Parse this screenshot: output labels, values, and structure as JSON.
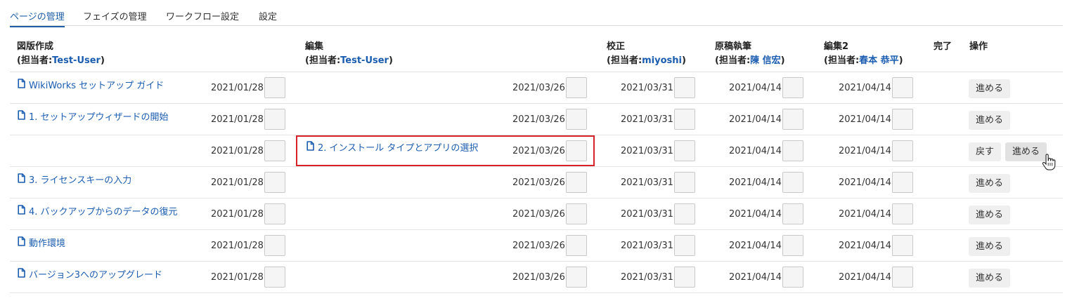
{
  "tabs": [
    {
      "label": "ページの管理",
      "active": true
    },
    {
      "label": "フェイズの管理",
      "active": false
    },
    {
      "label": "ワークフロー設定",
      "active": false
    },
    {
      "label": "設定",
      "active": false
    }
  ],
  "columns": {
    "zuhan": {
      "title": "図版作成",
      "assignee_prefix": "(担当者:",
      "assignee": "Test-User",
      "assignee_suffix": ")"
    },
    "henshu": {
      "title": "編集",
      "assignee_prefix": "(担当者:",
      "assignee": "Test-User",
      "assignee_suffix": ")"
    },
    "kosei": {
      "title": "校正",
      "assignee_prefix": "(担当者:",
      "assignee": "miyoshi",
      "assignee_suffix": ")"
    },
    "genko": {
      "title": "原稿執筆",
      "assignee_prefix": "(担当者:",
      "assignee": "陳 信宏",
      "assignee_suffix": ")"
    },
    "henshu2": {
      "title": "編集2",
      "assignee_prefix": "(担当者:",
      "assignee": "春本 恭平",
      "assignee_suffix": ")"
    },
    "kanryo": {
      "title": "完了"
    },
    "sosa": {
      "title": "操作"
    }
  },
  "rows": [
    {
      "page": "WikiWorks セットアップ ガイド",
      "d1": "2021/01/28",
      "d2": "2021/03/26",
      "d3": "2021/03/31",
      "d4": "2021/04/14",
      "d5": "2021/04/14",
      "advance": "進める"
    },
    {
      "page": "1. セットアップウィザードの開始",
      "d1": "2021/01/28",
      "d2": "2021/03/26",
      "d3": "2021/03/31",
      "d4": "2021/04/14",
      "d5": "2021/04/14",
      "advance": "進める"
    },
    {
      "page": "2. インストール タイプとアプリの選択",
      "d1": "2021/01/28",
      "d2": "2021/03/26",
      "d3": "2021/03/31",
      "d4": "2021/04/14",
      "d5": "2021/04/14",
      "back": "戻す",
      "advance": "進める"
    },
    {
      "page": "3. ライセンスキーの入力",
      "d1": "2021/01/28",
      "d2": "2021/03/26",
      "d3": "2021/03/31",
      "d4": "2021/04/14",
      "d5": "2021/04/14",
      "advance": "進める"
    },
    {
      "page": "4. バックアップからのデータの復元",
      "d1": "2021/01/28",
      "d2": "2021/03/26",
      "d3": "2021/03/31",
      "d4": "2021/04/14",
      "d5": "2021/04/14",
      "advance": "進める"
    },
    {
      "page": "動作環境",
      "d1": "2021/01/28",
      "d2": "2021/03/26",
      "d3": "2021/03/31",
      "d4": "2021/04/14",
      "d5": "2021/04/14",
      "advance": "進める"
    },
    {
      "page": "バージョン3へのアップグレード",
      "d1": "2021/01/28",
      "d2": "2021/03/26",
      "d3": "2021/03/31",
      "d4": "2021/04/14",
      "d5": "2021/04/14",
      "advance": "進める"
    }
  ],
  "icons": {
    "page": "document-icon",
    "cursor": "hand-pointer-icon"
  },
  "colors": {
    "link": "#1a5cb0",
    "highlight": "#d6232b"
  }
}
